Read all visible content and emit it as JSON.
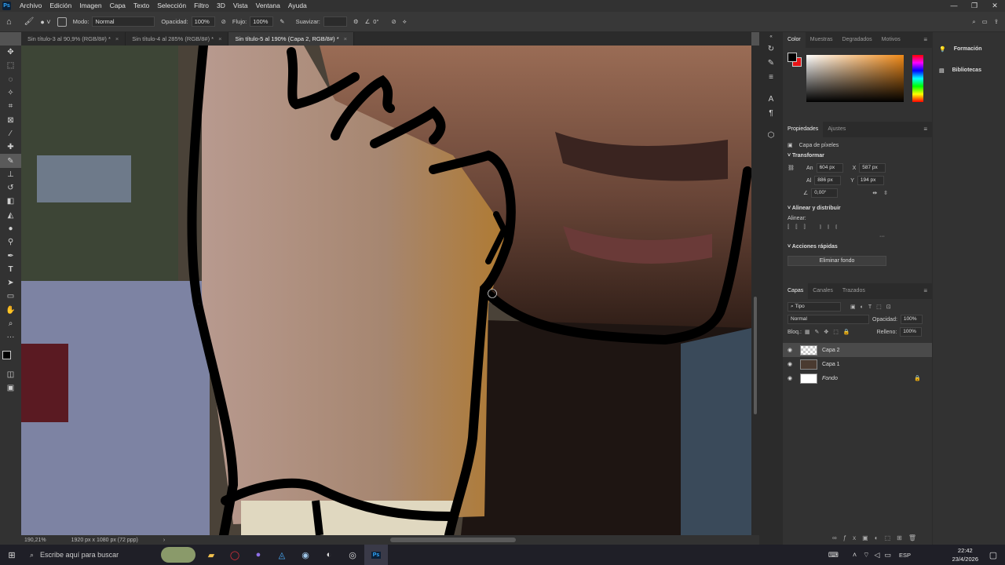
{
  "menubar": {
    "logo": "Ps",
    "items": [
      "Archivo",
      "Edición",
      "Imagen",
      "Capa",
      "Texto",
      "Selección",
      "Filtro",
      "3D",
      "Vista",
      "Ventana",
      "Ayuda"
    ]
  },
  "options": {
    "modo_label": "Modo:",
    "modo_value": "Normal",
    "opacidad_label": "Opacidad:",
    "opacidad_value": "100%",
    "flujo_label": "Flujo:",
    "flujo_value": "100%",
    "suavizar_label": "Suavizar:",
    "angle_value": "0°"
  },
  "tabs": [
    {
      "label": "Sin título-3 al 90,9% (RGB/8#) *"
    },
    {
      "label": "Sin título-4 al 285% (RGB/8#) *"
    },
    {
      "label": "Sin título-5 al 190% (Capa 2, RGB/8#) *"
    }
  ],
  "tools": [
    "move-tool-icon",
    "marquee-tool-icon",
    "lasso-tool-icon",
    "quick-select-icon",
    "crop-tool-icon",
    "frame-tool-icon",
    "eyedropper-icon",
    "healing-brush-icon",
    "brush-tool-icon",
    "clone-stamp-icon",
    "history-brush-icon",
    "eraser-icon",
    "gradient-icon",
    "blur-icon",
    "dodge-icon",
    "pen-icon",
    "type-icon",
    "path-select-icon",
    "rectangle-icon",
    "hand-icon",
    "zoom-icon",
    "more-tools-icon"
  ],
  "status": {
    "zoom": "190,21%",
    "doc": "1920 px x 1080 px (72 ppp)"
  },
  "color_panel": {
    "tabs": [
      "Color",
      "Muestras",
      "Degradados",
      "Motivos"
    ],
    "fg": "#000000",
    "bg": "#e81416"
  },
  "props": {
    "tabs": [
      "Propiedades",
      "Ajustes"
    ],
    "layer_type": "Capa de píxeles",
    "transform_title": "Transformar",
    "an_label": "An",
    "an": "604 px",
    "x_label": "X",
    "x": "587 px",
    "al_label": "Al",
    "al": "886 px",
    "y_label": "Y",
    "y": "194 px",
    "angle": "0,00°",
    "align_title": "Alinear y distribuir",
    "align_label": "Alinear:",
    "quick_title": "Acciones rápidas",
    "remove_bg": "Eliminar fondo"
  },
  "layers": {
    "tabs": [
      "Capas",
      "Canales",
      "Trazados"
    ],
    "filter": "Tipo",
    "blend": "Normal",
    "opacity_label": "Opacidad:",
    "opacity": "100%",
    "lock_label": "Bloq.:",
    "fill_label": "Relleno:",
    "fill": "100%",
    "items": [
      {
        "name": "Capa 2"
      },
      {
        "name": "Capa 1"
      },
      {
        "name": "Fondo"
      }
    ]
  },
  "farright": {
    "items": [
      "Formación",
      "Bibliotecas"
    ]
  },
  "taskbar": {
    "search": "Escribe aquí para buscar",
    "lang": "ESP",
    "time": "22:42",
    "date": "23/4/2026"
  }
}
